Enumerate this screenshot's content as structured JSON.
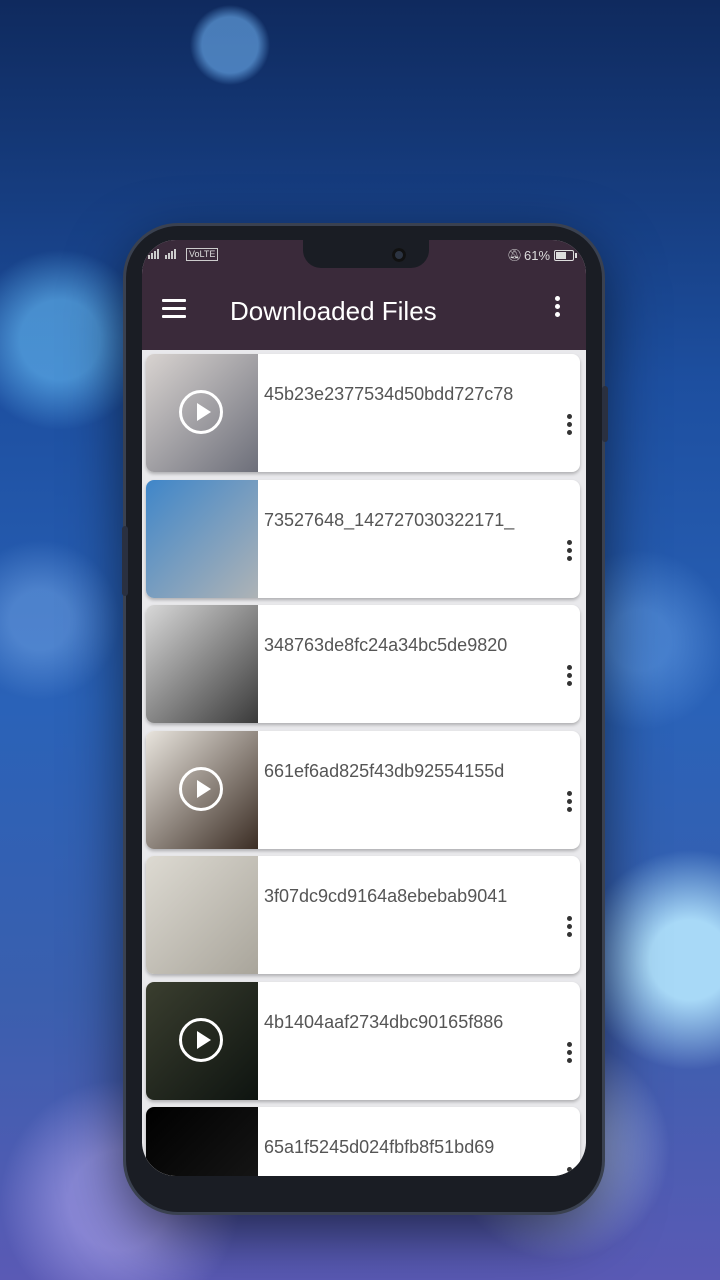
{
  "status_bar": {
    "network": "VoLTE",
    "battery": "61%",
    "battery_level": 0.61
  },
  "app_bar": {
    "menu_icon": "hamburger-menu-icon",
    "title": "Downloaded Files",
    "more_icon": "more-vert-icon"
  },
  "files": [
    {
      "name": "45b23e2377534d50bdd727c78",
      "is_video": true,
      "thumb_colors": [
        "#d8d3d0",
        "#6d6f7a"
      ]
    },
    {
      "name": "73527648_142727030322171_",
      "is_video": false,
      "thumb_colors": [
        "#3f86c9",
        "#aeb3b6"
      ]
    },
    {
      "name": "348763de8fc24a34bc5de9820",
      "is_video": false,
      "thumb_colors": [
        "#d8d8d8",
        "#3a3a3a"
      ]
    },
    {
      "name": "661ef6ad825f43db92554155d",
      "is_video": true,
      "thumb_colors": [
        "#e8e4dd",
        "#3b2d24"
      ]
    },
    {
      "name": "3f07dc9cd9164a8ebebab9041",
      "is_video": false,
      "thumb_colors": [
        "#dddad2",
        "#a9a59b"
      ]
    },
    {
      "name": "4b1404aaf2734dbc90165f886",
      "is_video": true,
      "thumb_colors": [
        "#3a3e2f",
        "#0e1410"
      ]
    },
    {
      "name": "65a1f5245d024fbfb8f51bd69",
      "is_video": false,
      "thumb_colors": [
        "#000000",
        "#1a1a1a"
      ]
    }
  ]
}
